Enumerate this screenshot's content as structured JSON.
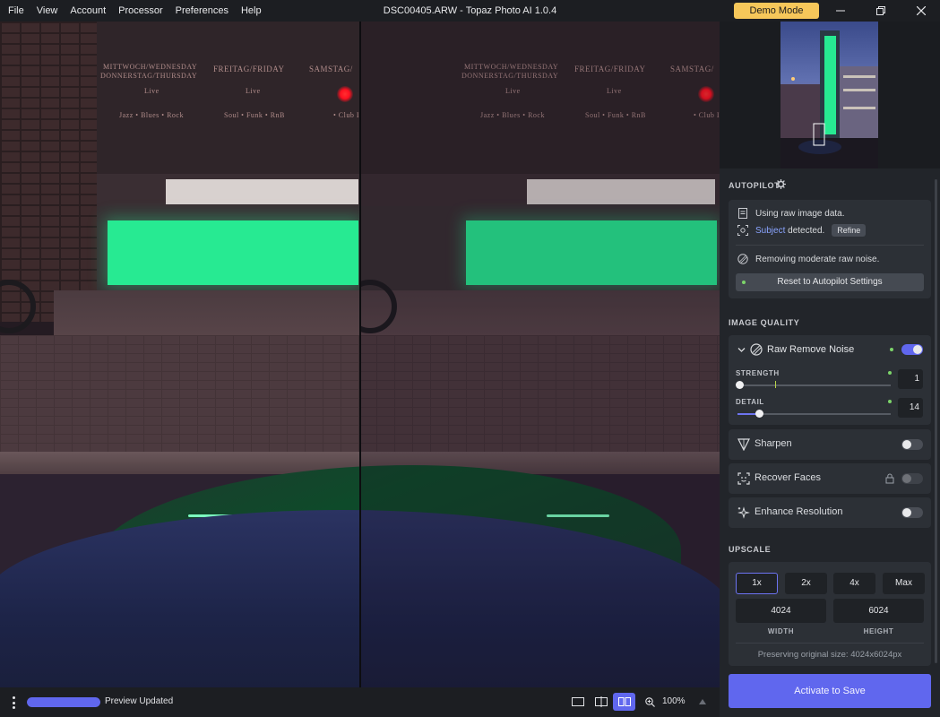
{
  "menu": [
    "File",
    "View",
    "Account",
    "Processor",
    "Preferences",
    "Help"
  ],
  "window_title": "DSC00405.ARW - Topaz Photo AI 1.0.4",
  "demo_badge": "Demo Mode",
  "photo_sign": {
    "day1_line1": "MITTWOCH/WEDNESDAY",
    "day1_line2": "DONNERSTAG/THURSDAY",
    "day1_sub1": "Live",
    "day1_sub2": "Jazz • Blues • Rock",
    "day2": "FREITAG/FRIDAY",
    "day2_sub1": "Live",
    "day2_sub2": "Soul • Funk • RnB",
    "day3": "SAMSTAG/",
    "day3_sub2": "• Club I"
  },
  "autopilot": {
    "title": "AUTOPILOT",
    "raw_data": "Using raw image data.",
    "subject_link": "Subject",
    "subject_rest": " detected.",
    "refine": "Refine",
    "noise_msg": "Removing moderate raw noise.",
    "reset": "Reset to Autopilot Settings"
  },
  "image_quality": {
    "title": "IMAGE QUALITY",
    "raw_remove_noise": "Raw Remove Noise",
    "raw_remove_noise_on": true,
    "strength_label": "STRENGTH",
    "strength_value": "1",
    "strength_level": 0.0,
    "detail_label": "DETAIL",
    "detail_value": "14",
    "detail_level": 0.14,
    "sharpen": "Sharpen",
    "recover_faces": "Recover Faces",
    "enhance_resolution": "Enhance Resolution"
  },
  "upscale": {
    "title": "UPSCALE",
    "options": [
      "1x",
      "2x",
      "4x",
      "Max"
    ],
    "selected": "1x",
    "width": "4024",
    "height": "6024",
    "width_label": "WIDTH",
    "height_label": "HEIGHT",
    "note": "Preserving original size: 4024x6024px"
  },
  "activate_label": "Activate to Save",
  "statusbar": {
    "status": "Preview Updated",
    "progress": 1.0,
    "zoom": "100%"
  },
  "colors": {
    "accent": "#6067ee",
    "demo": "#f6c75a",
    "link": "#8aa4ff"
  }
}
